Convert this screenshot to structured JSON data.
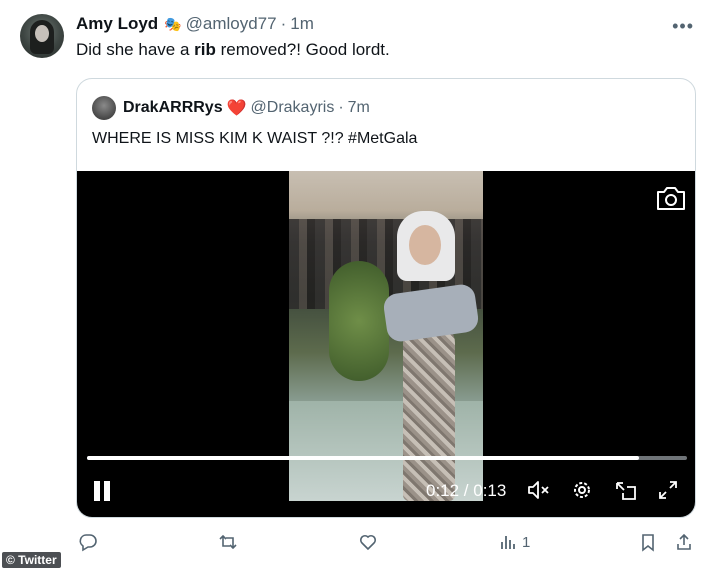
{
  "tweet": {
    "author_name": "Amy Loyd",
    "badge_icon": "theater-masks-icon",
    "handle": "@amloyd77",
    "separator": "·",
    "time": "1m",
    "text_before": "Did she have a ",
    "text_bold": "rib",
    "text_after": " removed?! Good lordt.",
    "more_icon": "more-options-icon"
  },
  "quoted_tweet": {
    "author_name": "DrakARRRys",
    "emoji": "❤️",
    "handle": "@Drakayris",
    "separator": "·",
    "time": "7m",
    "text": "WHERE IS MISS KIM K WAIST ?!? #MetGala"
  },
  "video": {
    "progress_fraction": 0.92,
    "time_readout": "0:12 / 0:13",
    "controls": [
      "pause-icon",
      "mute-icon",
      "gear-icon",
      "pip-icon",
      "expand-icon",
      "camera-icon"
    ]
  },
  "actions": {
    "reply_icon": "reply-icon",
    "retweet_icon": "retweet-icon",
    "like_icon": "heart-icon",
    "views_icon": "views-icon",
    "views_count": "1",
    "bookmark_icon": "bookmark-icon",
    "share_icon": "share-icon"
  },
  "watermark": "© Twitter"
}
